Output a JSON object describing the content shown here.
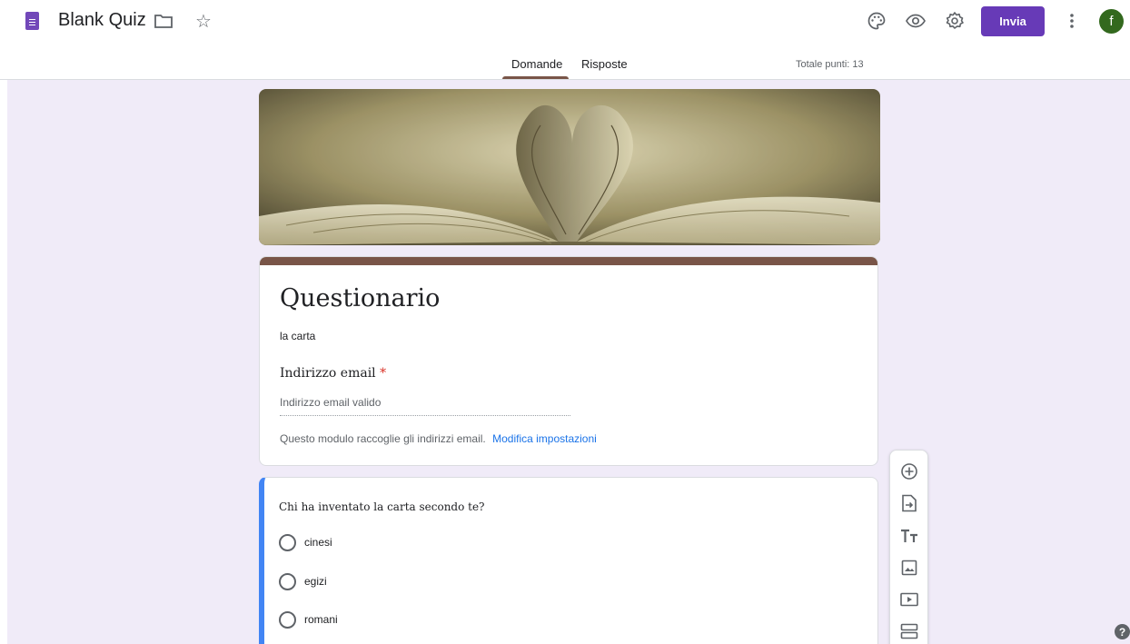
{
  "header": {
    "doc_title": "Blank Quiz",
    "icons": [
      "forms-logo-icon",
      "folder-icon",
      "star-icon",
      "palette-icon",
      "eye-icon",
      "settings-icon",
      "more-vert-icon"
    ],
    "send_label": "Invia",
    "avatar_letter": "f",
    "accent": "#673ab7"
  },
  "tabs": [
    {
      "label": "Domande",
      "active": true
    },
    {
      "label": "Risposte",
      "active": false
    }
  ],
  "total_points": "Totale punti: 13",
  "form": {
    "title": "Questionario",
    "description": "la carta",
    "email_label": "Indirizzo email",
    "required_mark": "*",
    "email_placeholder": "Indirizzo email valido",
    "collect_note": "Questo modulo raccoglie gli indirizzi email.",
    "collect_link": "Modifica impostazioni",
    "theme_color": "#795548"
  },
  "question": {
    "text": "Chi ha inventato la carta secondo te?",
    "options": [
      "cinesi",
      "egizi",
      "romani"
    ]
  },
  "toolbar": {
    "icons": [
      "add-question-icon",
      "import-questions-icon",
      "add-title-icon",
      "add-image-icon",
      "add-video-icon",
      "add-section-icon"
    ]
  },
  "help_glyph": "?"
}
